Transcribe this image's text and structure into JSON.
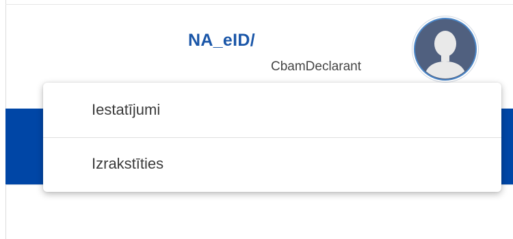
{
  "header": {
    "username": "NA_eID/",
    "role": "CbamDeclarant",
    "avatar_icon": "user-avatar-icon",
    "avatar_color": "#50607f"
  },
  "user_menu": {
    "items": [
      {
        "label": "Iestatījumi"
      },
      {
        "label": "Izrakstīties"
      }
    ]
  },
  "colors": {
    "brand_blue": "#0046a6",
    "username_blue": "#1a56a8"
  }
}
